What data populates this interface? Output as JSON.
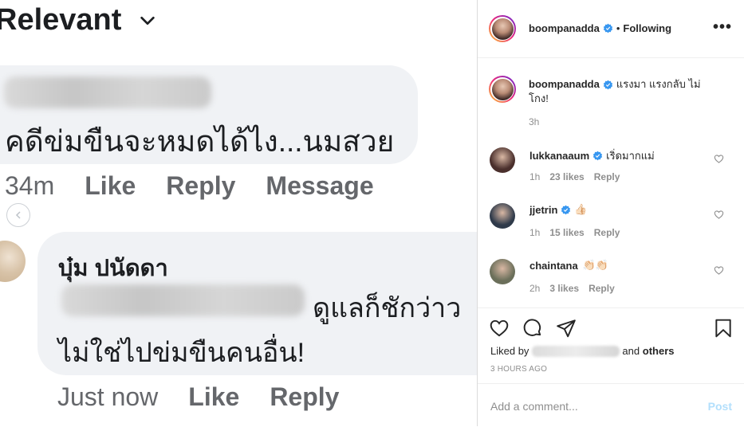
{
  "facebook": {
    "sort_label": "Relevant",
    "comment1": {
      "text": "คดีข่มขืนจะหมดได้ไง...นมสวย",
      "time": "34m",
      "like": "Like",
      "reply": "Reply",
      "message": "Message"
    },
    "comment2": {
      "author": "บุ๋ม ปนัดดา",
      "text_line1": "ดูแลก็ชักว่าว",
      "text_line2": "ไม่ใช่ไปข่มขืนคนอื่น!",
      "time": "Just now",
      "like": "Like",
      "reply": "Reply"
    }
  },
  "instagram": {
    "header": {
      "username": "boompanadda",
      "separator": "•",
      "follow_status": "Following",
      "more": "•••"
    },
    "caption": {
      "username": "boompanadda",
      "text": "แรงมา แรงกลับ ไม่โกง!",
      "time": "3h"
    },
    "comments": [
      {
        "username": "lukkanaaum",
        "verified": true,
        "text": "เริ่ดมากแม่",
        "time": "1h",
        "likes": "23 likes",
        "reply": "Reply",
        "avatar_color": "#4a2f2c"
      },
      {
        "username": "jjetrin",
        "verified": true,
        "text": "👍🏻",
        "time": "1h",
        "likes": "15 likes",
        "reply": "Reply",
        "avatar_color": "#2f3a4a"
      },
      {
        "username": "chaintana",
        "verified": false,
        "text": "👏🏻👏🏻",
        "time": "2h",
        "likes": "3 likes",
        "reply": "Reply",
        "avatar_color": "#6b6f5a"
      }
    ],
    "liked_by_prefix": "Liked by",
    "liked_by_suffix": "and",
    "liked_by_others": "others",
    "posted_ago": "3 HOURS AGO",
    "add_comment_placeholder": "Add a comment...",
    "post_button": "Post",
    "colors": {
      "verified_blue": "#3897f0",
      "post_disabled": "#b2dffc"
    }
  }
}
